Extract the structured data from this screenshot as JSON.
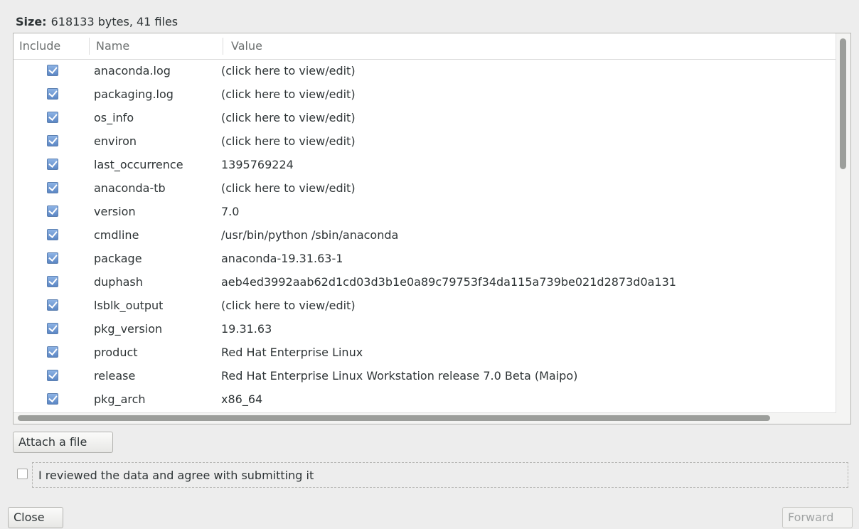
{
  "size": {
    "label": "Size:",
    "value": "618133 bytes, 41 files"
  },
  "table": {
    "headers": [
      "Include",
      "Name",
      "Value"
    ],
    "rows": [
      {
        "name": "anaconda.log",
        "value": "(click here to view/edit)",
        "included": true
      },
      {
        "name": "packaging.log",
        "value": "(click here to view/edit)",
        "included": true
      },
      {
        "name": "os_info",
        "value": "(click here to view/edit)",
        "included": true
      },
      {
        "name": "environ",
        "value": "(click here to view/edit)",
        "included": true
      },
      {
        "name": "last_occurrence",
        "value": "1395769224",
        "included": true
      },
      {
        "name": "anaconda-tb",
        "value": "(click here to view/edit)",
        "included": true
      },
      {
        "name": "version",
        "value": "7.0",
        "included": true
      },
      {
        "name": "cmdline",
        "value": "/usr/bin/python  /sbin/anaconda",
        "included": true
      },
      {
        "name": "package",
        "value": "anaconda-19.31.63-1",
        "included": true
      },
      {
        "name": "duphash",
        "value": "aeb4ed3992aab62d1cd03d3b1e0a89c79753f34da115a739be021d2873d0a131",
        "included": true
      },
      {
        "name": "lsblk_output",
        "value": "(click here to view/edit)",
        "included": true
      },
      {
        "name": "pkg_version",
        "value": "19.31.63",
        "included": true
      },
      {
        "name": "product",
        "value": "Red Hat Enterprise Linux",
        "included": true
      },
      {
        "name": "release",
        "value": "Red Hat Enterprise Linux Workstation release 7.0 Beta (Maipo)",
        "included": true
      },
      {
        "name": "pkg_arch",
        "value": "x86_64",
        "included": true
      }
    ]
  },
  "buttons": {
    "attach": "Attach a file",
    "close": "Close",
    "forward": "Forward"
  },
  "agree": {
    "label": "I reviewed the data and agree with submitting it",
    "checked": false
  }
}
